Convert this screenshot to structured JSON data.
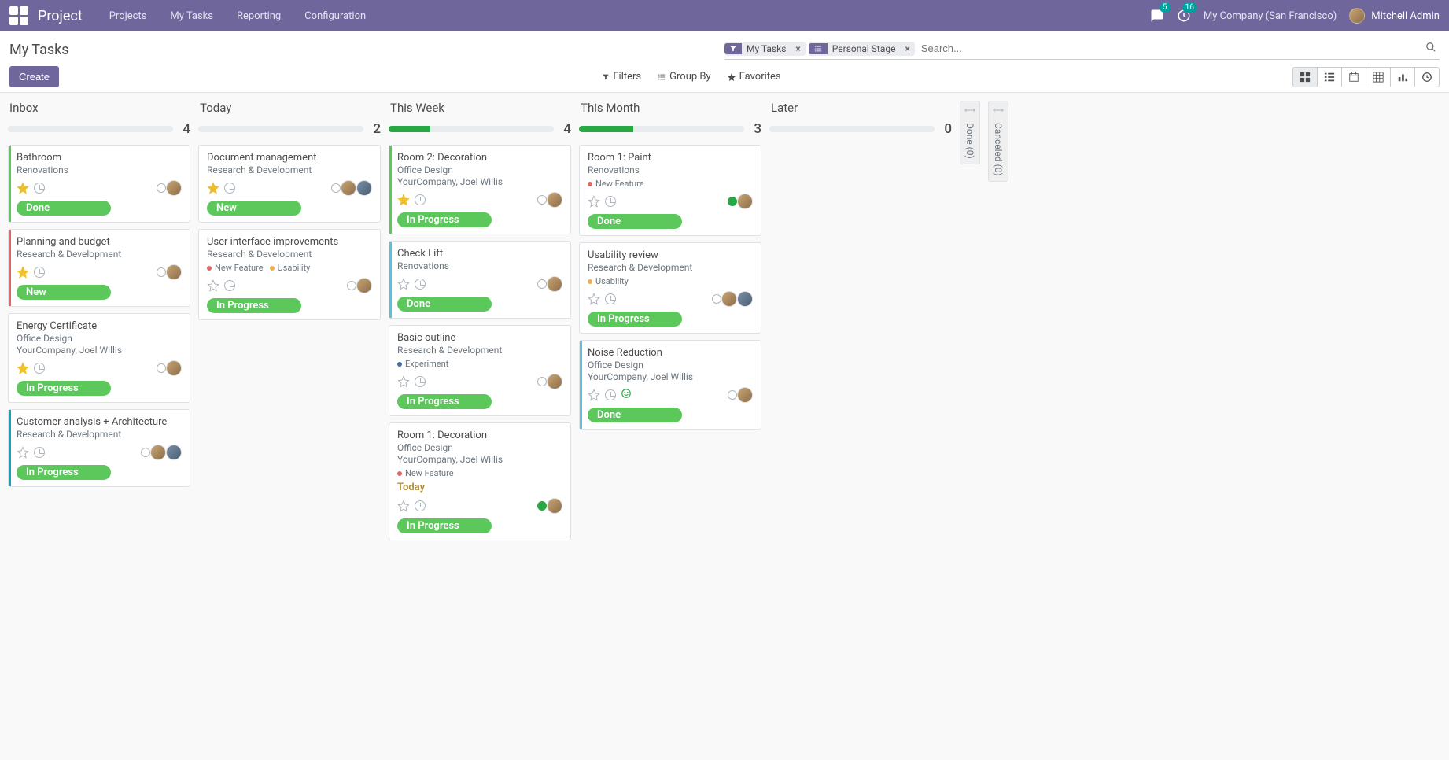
{
  "header": {
    "app_title": "Project",
    "nav": [
      "Projects",
      "My Tasks",
      "Reporting",
      "Configuration"
    ],
    "chat_count": "5",
    "activity_count": "16",
    "company": "My Company (San Francisco)",
    "user": "Mitchell Admin"
  },
  "control": {
    "title": "My Tasks",
    "create": "Create",
    "facets": [
      {
        "type": "filter",
        "label": "My Tasks"
      },
      {
        "type": "group",
        "label": "Personal Stage"
      }
    ],
    "search_placeholder": "Search...",
    "filters": "Filters",
    "groupby": "Group By",
    "favorites": "Favorites"
  },
  "columns": [
    {
      "title": "Inbox",
      "count": "4",
      "progress_pct": 0,
      "cards": [
        {
          "band": "#5cc85c",
          "title": "Bathroom",
          "project": "Renovations",
          "extra": "",
          "tags": [],
          "deadline": "",
          "starred": true,
          "state": "normal",
          "avatars": 1,
          "pill": "Done"
        },
        {
          "band": "#dc6965",
          "title": "Planning and budget",
          "project": "Research & Development",
          "extra": "",
          "tags": [],
          "deadline": "",
          "starred": true,
          "state": "normal",
          "avatars": 1,
          "pill": "New"
        },
        {
          "band": "",
          "title": "Energy Certificate",
          "project": "Office Design",
          "extra": "YourCompany, Joel Willis",
          "tags": [],
          "deadline": "",
          "starred": true,
          "state": "normal",
          "avatars": 1,
          "pill": "In Progress"
        },
        {
          "band": "#17a2b8",
          "title": "Customer analysis + Architecture",
          "project": "Research & Development",
          "extra": "",
          "tags": [],
          "deadline": "",
          "starred": false,
          "state": "normal",
          "avatars": 2,
          "pill": "In Progress"
        }
      ]
    },
    {
      "title": "Today",
      "count": "2",
      "progress_pct": 0,
      "cards": [
        {
          "band": "",
          "title": "Document management",
          "project": "Research & Development",
          "extra": "",
          "tags": [],
          "deadline": "",
          "starred": true,
          "state": "normal",
          "avatars": 2,
          "pill": "New"
        },
        {
          "band": "",
          "title": "User interface improvements",
          "project": "Research & Development",
          "extra": "",
          "tags": [
            {
              "color": "#dc6965",
              "label": "New Feature"
            },
            {
              "color": "#f0ad4e",
              "label": "Usability"
            }
          ],
          "deadline": "",
          "starred": false,
          "state": "normal",
          "avatars": 1,
          "pill": "In Progress"
        }
      ]
    },
    {
      "title": "This Week",
      "count": "4",
      "progress_pct": 25,
      "cards": [
        {
          "band": "#5cc85c",
          "title": "Room 2: Decoration",
          "project": "Office Design",
          "extra": "YourCompany, Joel Willis",
          "tags": [],
          "deadline": "",
          "starred": true,
          "state": "normal",
          "avatars": 1,
          "pill": "In Progress"
        },
        {
          "band": "#5bc0de",
          "title": "Check Lift",
          "project": "Renovations",
          "extra": "",
          "tags": [],
          "deadline": "",
          "starred": false,
          "state": "normal",
          "avatars": 1,
          "pill": "Done"
        },
        {
          "band": "",
          "title": "Basic outline",
          "project": "Research & Development",
          "extra": "",
          "tags": [
            {
              "color": "#4a6fa5",
              "label": "Experiment"
            }
          ],
          "deadline": "",
          "starred": false,
          "state": "normal",
          "avatars": 1,
          "pill": "In Progress"
        },
        {
          "band": "",
          "title": "Room 1: Decoration",
          "project": "Office Design",
          "extra": "YourCompany, Joel Willis",
          "tags": [
            {
              "color": "#dc6965",
              "label": "New Feature"
            }
          ],
          "deadline": "Today",
          "deadline_color": "#b08d3b",
          "starred": false,
          "state": "done",
          "avatars": 1,
          "pill": "In Progress"
        }
      ]
    },
    {
      "title": "This Month",
      "count": "3",
      "progress_pct": 33,
      "cards": [
        {
          "band": "",
          "title": "Room 1: Paint",
          "project": "Renovations",
          "extra": "",
          "tags": [
            {
              "color": "#dc6965",
              "label": "New Feature"
            }
          ],
          "deadline": "",
          "starred": false,
          "state": "done",
          "avatars": 1,
          "pill": "Done"
        },
        {
          "band": "",
          "title": "Usability review",
          "project": "Research & Development",
          "extra": "",
          "tags": [
            {
              "color": "#f0ad4e",
              "label": "Usability"
            }
          ],
          "deadline": "",
          "starred": false,
          "state": "normal",
          "avatars": 2,
          "pill": "In Progress"
        },
        {
          "band": "#5bc0de",
          "title": "Noise Reduction",
          "project": "Office Design",
          "extra": "YourCompany, Joel Willis",
          "tags": [],
          "deadline": "",
          "starred": false,
          "state": "normal",
          "avatars": 1,
          "pill": "Done",
          "smile": true
        }
      ]
    },
    {
      "title": "Later",
      "count": "0",
      "progress_pct": 0,
      "cards": []
    }
  ],
  "folded": [
    {
      "label": "Done (0)"
    },
    {
      "label": "Canceled (0)"
    }
  ]
}
